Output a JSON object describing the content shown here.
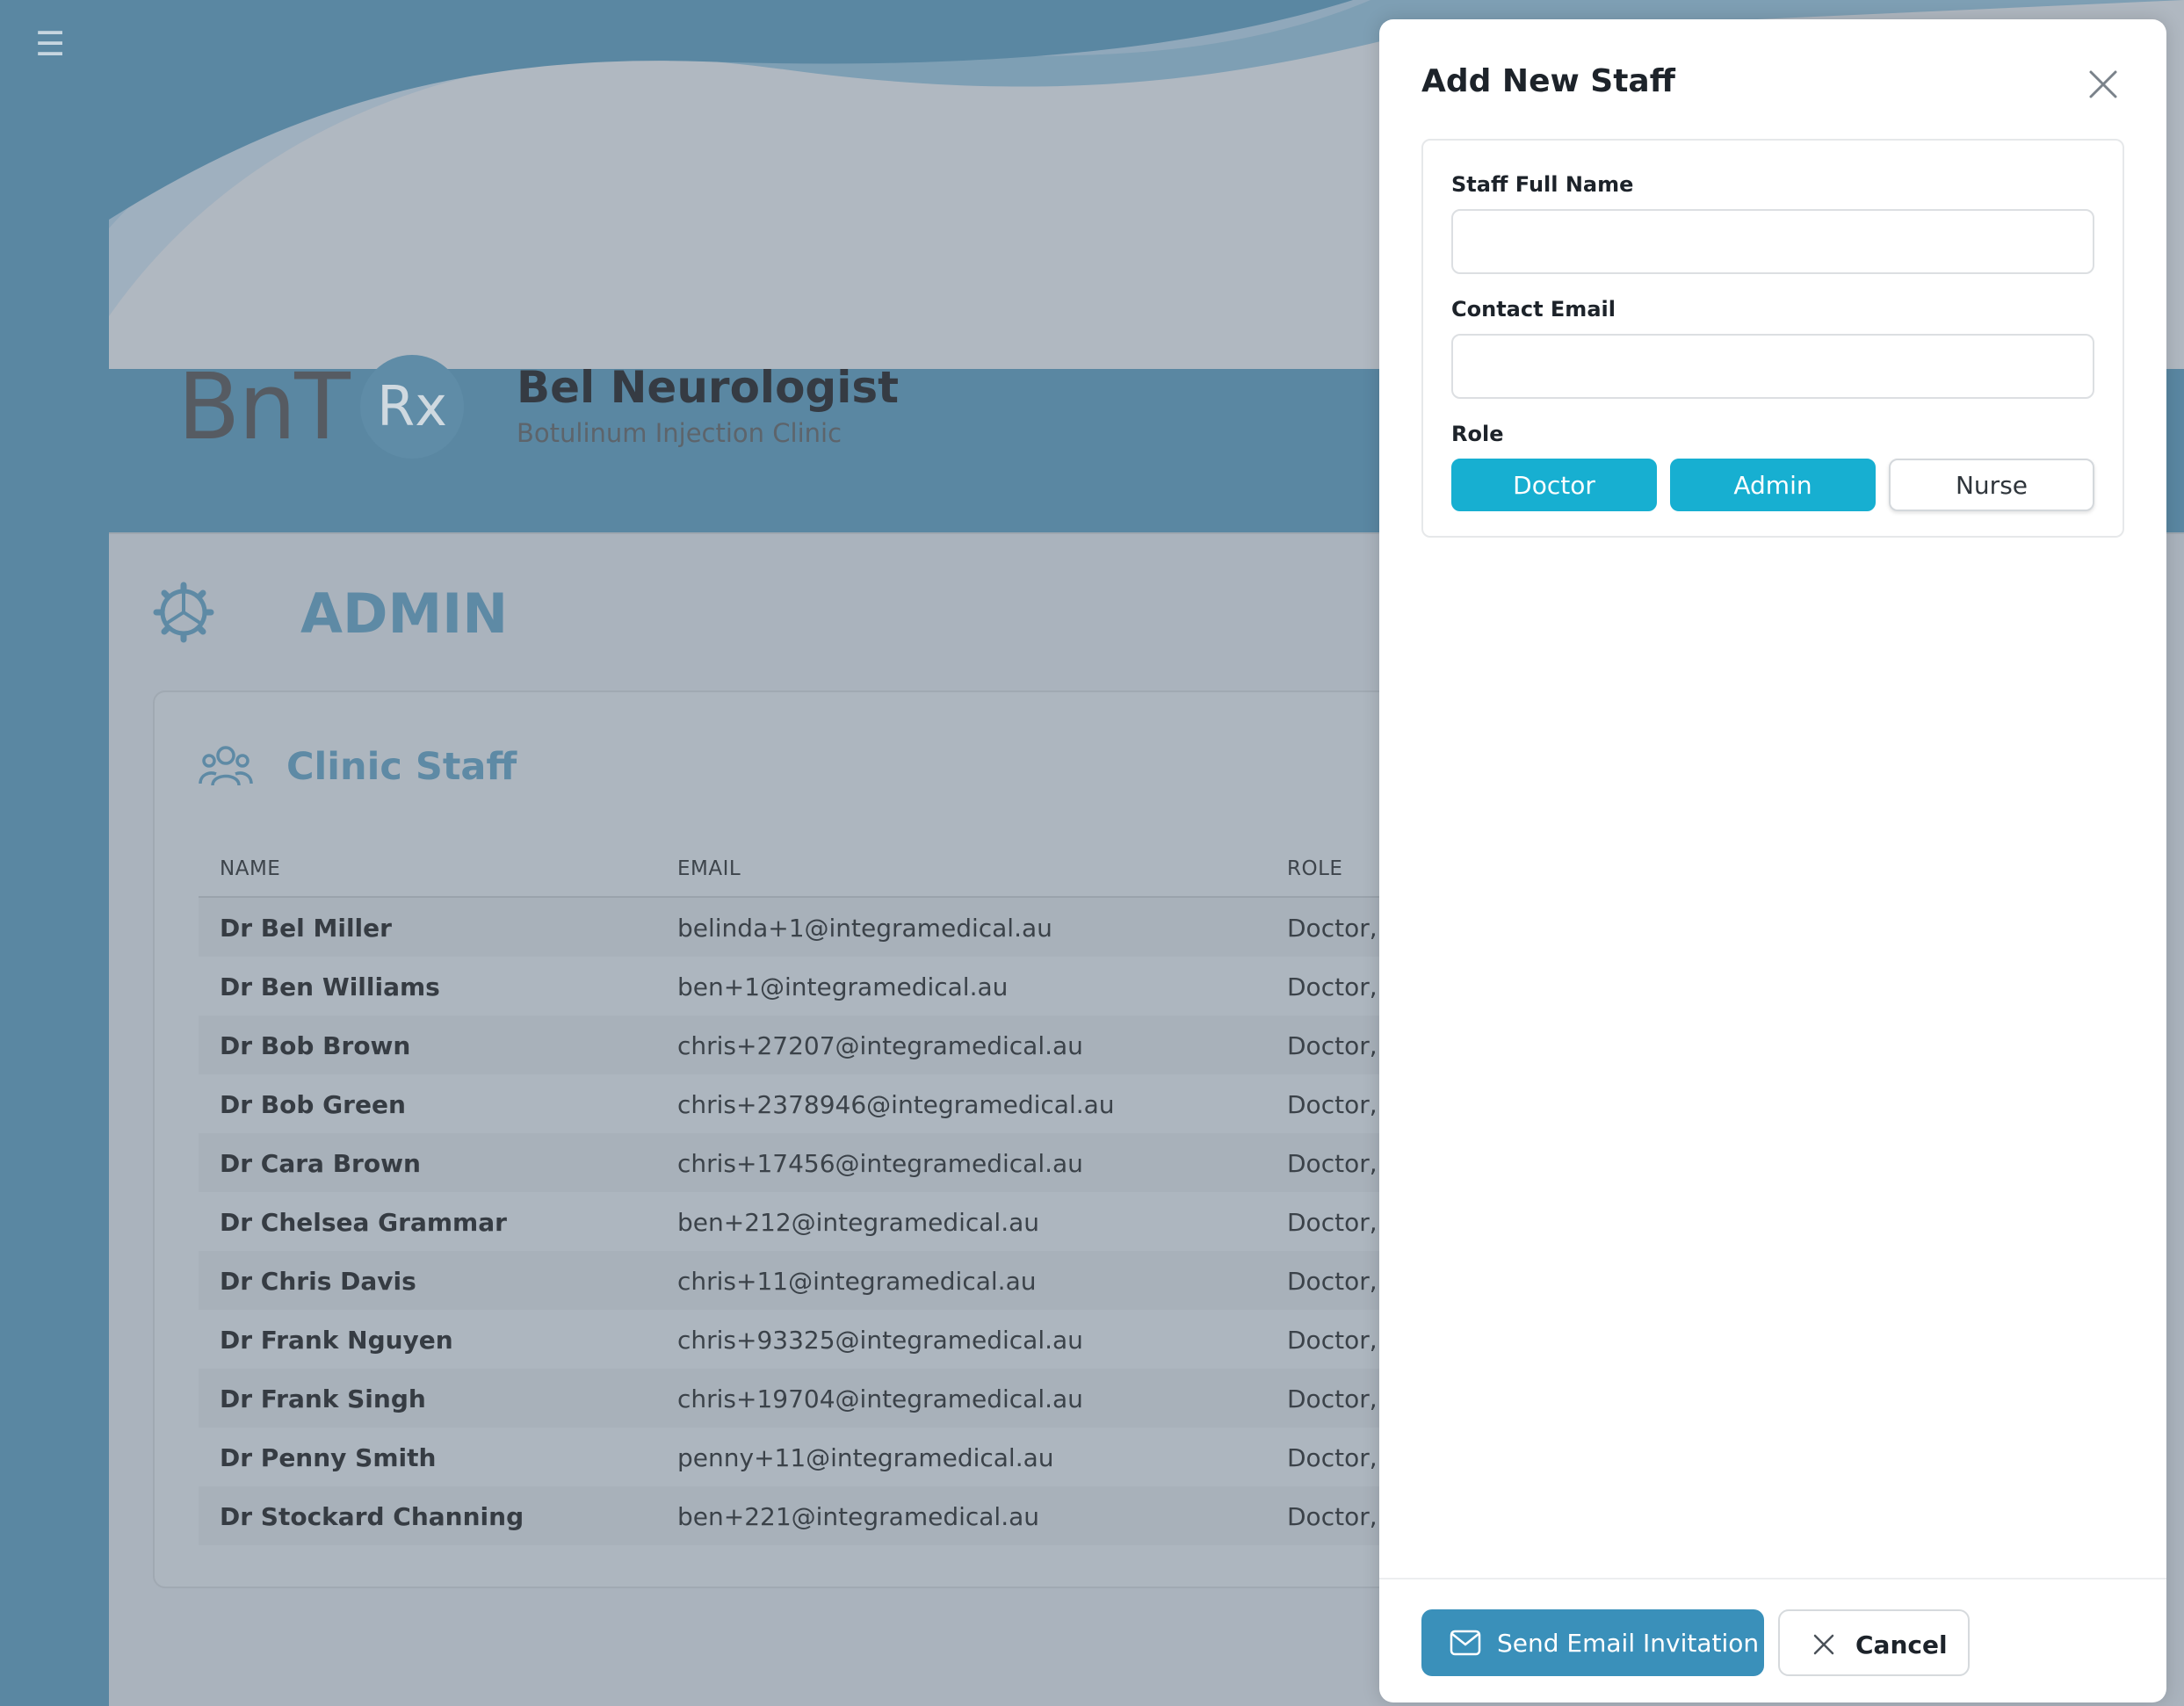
{
  "nav": {
    "menu_icon": "hamburger-icon",
    "menu_glyph": "☰"
  },
  "brand": {
    "logo_text": "BnT",
    "logo_rx": "Rx",
    "clinic_name": "Bel Neurologist",
    "clinic_subtitle": "Botulinum Injection Clinic"
  },
  "admin": {
    "title": "ADMIN",
    "icon": "gear-icon"
  },
  "staff": {
    "title": "Clinic Staff",
    "icon": "people-icon",
    "columns": [
      "NAME",
      "EMAIL",
      "ROLE"
    ],
    "rows": [
      {
        "name": "Dr Bel Miller",
        "email": "belinda+1@integramedical.au",
        "role": "Doctor, A"
      },
      {
        "name": "Dr Ben Williams",
        "email": "ben+1@integramedical.au",
        "role": "Doctor, A"
      },
      {
        "name": "Dr Bob Brown",
        "email": "chris+27207@integramedical.au",
        "role": "Doctor, A"
      },
      {
        "name": "Dr Bob Green",
        "email": "chris+2378946@integramedical.au",
        "role": "Doctor, A"
      },
      {
        "name": "Dr Cara Brown",
        "email": "chris+17456@integramedical.au",
        "role": "Doctor, A"
      },
      {
        "name": "Dr Chelsea Grammar",
        "email": "ben+212@integramedical.au",
        "role": "Doctor, A"
      },
      {
        "name": "Dr Chris Davis",
        "email": "chris+11@integramedical.au",
        "role": "Doctor, A"
      },
      {
        "name": "Dr Frank Nguyen",
        "email": "chris+93325@integramedical.au",
        "role": "Doctor, A"
      },
      {
        "name": "Dr Frank Singh",
        "email": "chris+19704@integramedical.au",
        "role": "Doctor, A"
      },
      {
        "name": "Dr Penny Smith",
        "email": "penny+11@integramedical.au",
        "role": "Doctor, A"
      },
      {
        "name": "Dr Stockard Channing",
        "email": "ben+221@integramedical.au",
        "role": "Doctor, A"
      }
    ]
  },
  "modal": {
    "title": "Add New Staff",
    "close_icon": "close-icon",
    "name_label": "Staff Full Name",
    "name_value": "",
    "email_label": "Contact Email",
    "email_value": "",
    "role_label": "Role",
    "roles": [
      {
        "label": "Doctor",
        "selected": true
      },
      {
        "label": "Admin",
        "selected": true
      },
      {
        "label": "Nurse",
        "selected": false
      }
    ],
    "send_label": "Send Email Invitation",
    "send_icon": "mail-icon",
    "cancel_label": "Cancel",
    "cancel_icon": "x-icon"
  },
  "colors": {
    "sidebar": "#5a87a2",
    "accent": "#5e8aa5",
    "role_selected": "#17afd1",
    "send_button": "#3a90ba"
  }
}
